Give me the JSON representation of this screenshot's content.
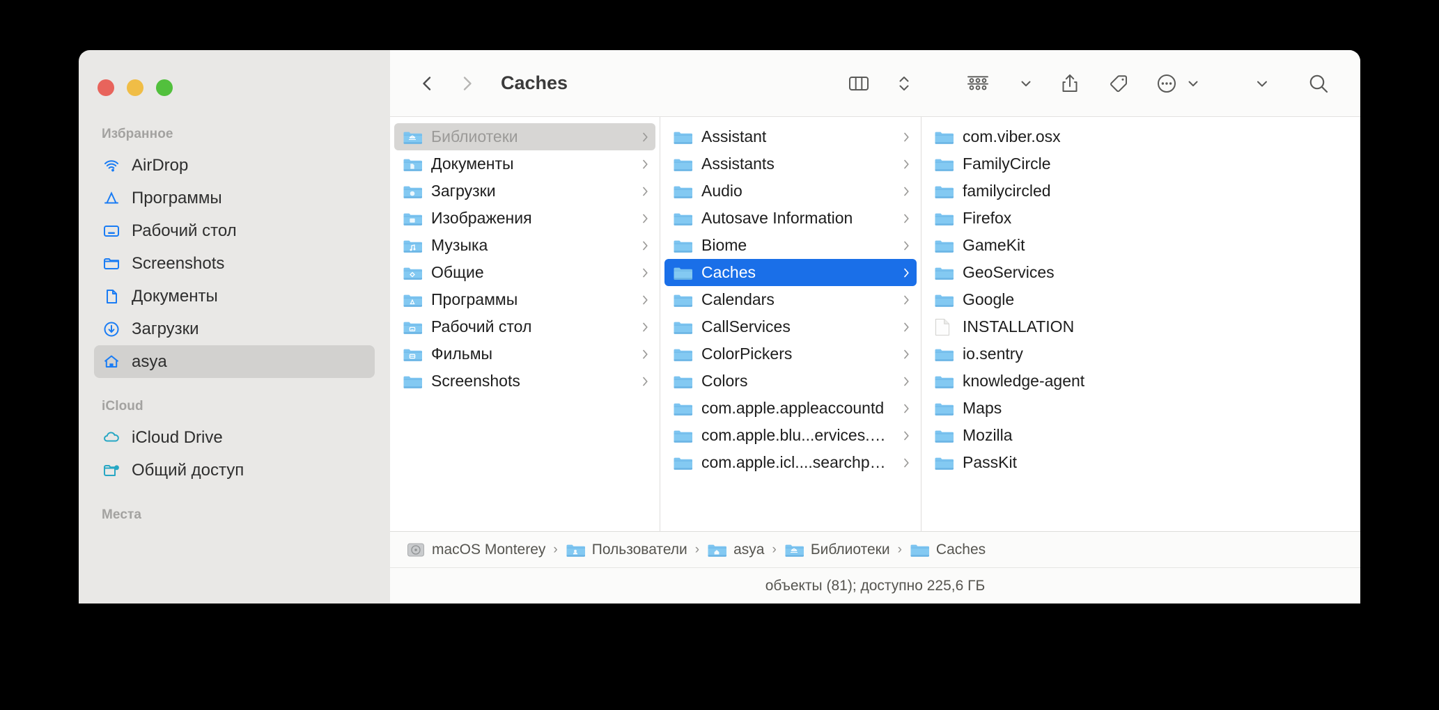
{
  "window": {
    "title": "Caches",
    "traffic_lights": [
      "close-button",
      "minimize-button",
      "zoom-button"
    ]
  },
  "toolbar": {
    "back_icon": "chevron-left-icon",
    "forward_icon": "chevron-right-icon",
    "view_column_icon": "column-view-icon",
    "view_stepper_icon": "up-down-chevron-icon",
    "group_icon": "group-by-icon",
    "group_chevron_icon": "chevron-down-icon",
    "share_icon": "share-icon",
    "tag_icon": "tag-icon",
    "more_icon": "ellipsis-circle-icon",
    "more_chevron_icon": "chevron-down-icon",
    "overflow_chevron_icon": "chevron-down-icon",
    "search_icon": "search-icon"
  },
  "sidebar": {
    "sections": [
      {
        "title": "Избранное",
        "items": [
          {
            "label": "AirDrop",
            "icon": "airdrop-icon",
            "selected": false
          },
          {
            "label": "Программы",
            "icon": "apps-icon",
            "selected": false
          },
          {
            "label": "Рабочий стол",
            "icon": "desktop-icon",
            "selected": false
          },
          {
            "label": "Screenshots",
            "icon": "folder-icon",
            "selected": false
          },
          {
            "label": "Документы",
            "icon": "document-icon",
            "selected": false
          },
          {
            "label": "Загрузки",
            "icon": "downloads-icon",
            "selected": false
          },
          {
            "label": "asya",
            "icon": "home-icon",
            "selected": true
          }
        ]
      },
      {
        "title": "iCloud",
        "items": [
          {
            "label": "iCloud Drive",
            "icon": "cloud-icon",
            "selected": false
          },
          {
            "label": "Общий доступ",
            "icon": "shared-folder-icon",
            "selected": false
          }
        ]
      },
      {
        "title": "Места",
        "items": []
      }
    ]
  },
  "columns": [
    {
      "name": "column-library",
      "items": [
        {
          "label": "Библиотеки",
          "icon": "folder-library-icon",
          "chevron": true,
          "selected": "inactive"
        },
        {
          "label": "Документы",
          "icon": "folder-documents-icon",
          "chevron": true,
          "selected": "none"
        },
        {
          "label": "Загрузки",
          "icon": "folder-downloads-icon",
          "chevron": true,
          "selected": "none"
        },
        {
          "label": "Изображения",
          "icon": "folder-pictures-icon",
          "chevron": true,
          "selected": "none"
        },
        {
          "label": "Музыка",
          "icon": "folder-music-icon",
          "chevron": true,
          "selected": "none"
        },
        {
          "label": "Общие",
          "icon": "folder-public-icon",
          "chevron": true,
          "selected": "none"
        },
        {
          "label": "Программы",
          "icon": "folder-apps-icon",
          "chevron": true,
          "selected": "none"
        },
        {
          "label": "Рабочий стол",
          "icon": "folder-desktop-icon",
          "chevron": true,
          "selected": "none"
        },
        {
          "label": "Фильмы",
          "icon": "folder-movies-icon",
          "chevron": true,
          "selected": "none"
        },
        {
          "label": "Screenshots",
          "icon": "folder-icon",
          "chevron": true,
          "selected": "none"
        }
      ]
    },
    {
      "name": "column-library-contents",
      "items": [
        {
          "label": "Assistant",
          "icon": "folder-icon",
          "chevron": true,
          "selected": "none"
        },
        {
          "label": "Assistants",
          "icon": "folder-icon",
          "chevron": true,
          "selected": "none"
        },
        {
          "label": "Audio",
          "icon": "folder-icon",
          "chevron": true,
          "selected": "none"
        },
        {
          "label": "Autosave Information",
          "icon": "folder-icon",
          "chevron": true,
          "selected": "none"
        },
        {
          "label": "Biome",
          "icon": "folder-icon",
          "chevron": true,
          "selected": "none"
        },
        {
          "label": "Caches",
          "icon": "folder-icon",
          "chevron": true,
          "selected": "active"
        },
        {
          "label": "Calendars",
          "icon": "folder-icon",
          "chevron": true,
          "selected": "none"
        },
        {
          "label": "CallServices",
          "icon": "folder-icon",
          "chevron": true,
          "selected": "none"
        },
        {
          "label": "ColorPickers",
          "icon": "folder-icon",
          "chevron": true,
          "selected": "none"
        },
        {
          "label": "Colors",
          "icon": "folder-icon",
          "chevron": true,
          "selected": "none"
        },
        {
          "label": "com.apple.appleaccountd",
          "icon": "folder-icon",
          "chevron": true,
          "selected": "none"
        },
        {
          "label": "com.apple.blu...ervices.cloud",
          "icon": "folder-icon",
          "chevron": true,
          "selected": "none"
        },
        {
          "label": "com.apple.icl....searchpartyd",
          "icon": "folder-icon",
          "chevron": true,
          "selected": "none"
        }
      ]
    },
    {
      "name": "column-caches-contents",
      "items": [
        {
          "label": "com.viber.osx",
          "icon": "folder-icon",
          "chevron": false,
          "selected": "none"
        },
        {
          "label": "FamilyCircle",
          "icon": "folder-icon",
          "chevron": false,
          "selected": "none"
        },
        {
          "label": "familycircled",
          "icon": "folder-icon",
          "chevron": false,
          "selected": "none"
        },
        {
          "label": "Firefox",
          "icon": "folder-icon",
          "chevron": false,
          "selected": "none"
        },
        {
          "label": "GameKit",
          "icon": "folder-icon",
          "chevron": false,
          "selected": "none"
        },
        {
          "label": "GeoServices",
          "icon": "folder-icon",
          "chevron": false,
          "selected": "none"
        },
        {
          "label": "Google",
          "icon": "folder-icon",
          "chevron": false,
          "selected": "none"
        },
        {
          "label": "INSTALLATION",
          "icon": "file-icon",
          "chevron": false,
          "selected": "none"
        },
        {
          "label": "io.sentry",
          "icon": "folder-icon",
          "chevron": false,
          "selected": "none"
        },
        {
          "label": "knowledge-agent",
          "icon": "folder-icon",
          "chevron": false,
          "selected": "none"
        },
        {
          "label": "Maps",
          "icon": "folder-icon",
          "chevron": false,
          "selected": "none"
        },
        {
          "label": "Mozilla",
          "icon": "folder-icon",
          "chevron": false,
          "selected": "none"
        },
        {
          "label": "PassKit",
          "icon": "folder-icon",
          "chevron": false,
          "selected": "none"
        }
      ]
    }
  ],
  "pathbar": {
    "separator": "›",
    "segments": [
      {
        "label": "macOS Monterey",
        "icon": "hard-drive-icon"
      },
      {
        "label": "Пользователи",
        "icon": "folder-users-icon"
      },
      {
        "label": "asya",
        "icon": "folder-home-icon"
      },
      {
        "label": "Библиотеки",
        "icon": "folder-library-icon"
      },
      {
        "label": "Caches",
        "icon": "folder-icon"
      }
    ]
  },
  "statusbar": {
    "text": "объекты (81); доступно 225,6 ГБ"
  },
  "colors": {
    "selection_active": "#1a6fe8",
    "selection_inactive": "#d7d6d4",
    "sidebar_bg": "#e9e8e6",
    "accent_blue": "#1a7cf4",
    "folder_blue": "#61b7ed"
  }
}
